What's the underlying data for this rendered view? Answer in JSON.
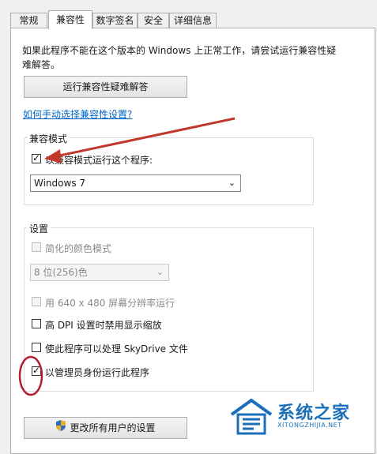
{
  "tabs": [
    "常规",
    "兼容性",
    "数字签名",
    "安全",
    "详细信息"
  ],
  "description": "如果此程序不能在这个版本的 Windows 上正常工作，请尝试运行兼容性疑难解答。",
  "troubleshoot_button": "运行兼容性疑难解答",
  "manual_link": "如何手动选择兼容性设置?",
  "compat_mode": {
    "group_label": "兼容模式",
    "checkbox_label": "以兼容模式运行这个程序:",
    "checked": true,
    "selected_os": "Windows 7"
  },
  "settings": {
    "group_label": "设置",
    "reduced_color": {
      "label": "简化的颜色模式",
      "checked": false,
      "enabled": false
    },
    "color_select": "8 位(256)色",
    "res_640": {
      "label": "用 640 x 480 屏幕分辨率运行",
      "checked": false,
      "enabled": false
    },
    "high_dpi": {
      "label": "高 DPI 设置时禁用显示缩放",
      "checked": false
    },
    "skydrive": {
      "label": "使此程序可以处理 SkyDrive 文件",
      "checked": false
    },
    "run_admin": {
      "label": "以管理员身份运行此程序",
      "checked": true
    }
  },
  "change_all_button": "更改所有用户的设置",
  "watermark": {
    "name": "系统之家",
    "url": "XITONGZHIJIA.NET"
  },
  "annotation_colors": {
    "arrow": "#c0392b",
    "circle": "#b0202a"
  }
}
